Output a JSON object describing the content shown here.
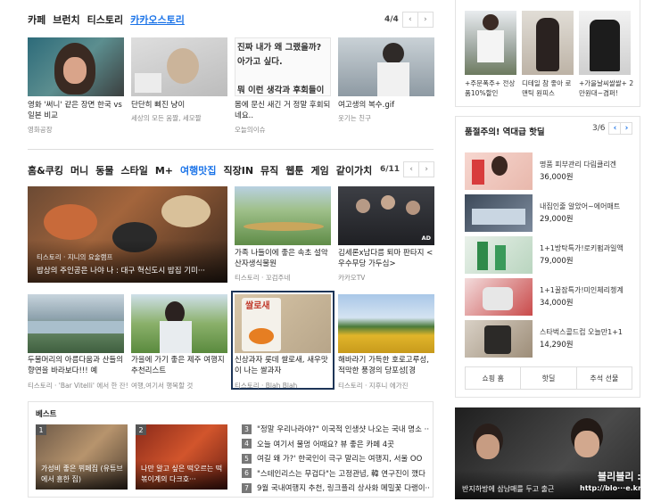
{
  "section1": {
    "tabs": [
      "카페",
      "브런치",
      "티스토리",
      "카카오스토리"
    ],
    "active_tab": 3,
    "page": "4/4",
    "cards": [
      {
        "title": "영화 '써니' 같은 장면 한국 vs 일본 비교",
        "source": "영화공장"
      },
      {
        "title": "단단히 삐진 냥이",
        "source": "세상의 모든 움짤, 세모짤"
      },
      {
        "title": "몸에 문신 새긴 거 정말 후회되네요..",
        "source": "오늘의이슈",
        "thumb_text": [
          "진짜 내가 왜 그랬을까?",
          "아가고 싶다.",
          "뭐 이런 생각과 후회들이"
        ]
      },
      {
        "title": "여고생의 복수.gif",
        "source": "웃기는 친구"
      }
    ]
  },
  "section2": {
    "tabs": [
      "홈&쿠킹",
      "머니",
      "동물",
      "스타일",
      "M+",
      "여행맛집",
      "직장IN",
      "뮤직",
      "웹툰",
      "게임",
      "같이가치"
    ],
    "active_tab": 5,
    "page": "6/11",
    "featured": {
      "source": "티스토리 · 지니의 요술램프",
      "title": "밥상의 주인공은 나야 나 : 대구 혁신도시 밥집 기미···"
    },
    "cards": [
      {
        "title": "가족 나들이에 좋은 속초 설악산자생식물원",
        "source": "티스토리 · 꼬검주네"
      },
      {
        "title": "김세론x남다름 퇴마 판타지 <우수무당 가두심>",
        "source": "카카오TV",
        "ad": "AD"
      },
      {
        "title": "두물머리의 아름다움과 산들의 향연을 바라보다!!! 예",
        "source": "티스토리 · 'Bar Vitelli' 에서 한 잔!"
      },
      {
        "title": "가을에 가기 좋은 제주 여행지 추천리스트",
        "source": "여행,여기서 행복할 것"
      },
      {
        "title": "신상과자 롯데 쌀로새, 새우맛이 나는 쌀과자",
        "source": "티스토리 · Blah Blah",
        "thumb_text": "쌀로새"
      },
      {
        "title": "해바라기 가득한 호로고루성, 적막한 풍경의 당포성[경",
        "source": "티스토리 · 지후니 에가진"
      }
    ]
  },
  "best": {
    "label": "베스트",
    "cards": [
      {
        "rank": "1",
        "title": "가성비 좋은 뷔페집 (유튜브에서 흥한 집)"
      },
      {
        "rank": "2",
        "title": "나만 알고 싶은 떡오르는 떡볶이계의 다크호···"
      }
    ],
    "list": [
      {
        "rank": "3",
        "title": "\"정말 우리나라야?\" 이국적 인생샷 나오는 국내 명소 ···"
      },
      {
        "rank": "4",
        "title": "오늘 여기서 물멍 어때요? 뷰 좋은 카페 4곳"
      },
      {
        "rank": "5",
        "title": "여길 왜 가?' 한국인이 극구 말리는 여행지, 서울 OO"
      },
      {
        "rank": "6",
        "title": "\"스테인리스는 무겁다\"는 고정관념, 韓 연구진이 깼다"
      },
      {
        "rank": "7",
        "title": "9월 국내여행지 추천, 링크플리 상사화 메밀꽃 다랭이···"
      }
    ]
  },
  "sidebar": {
    "top_items": [
      {
        "text": "+주문폭주+ 전상품10%할인"
      },
      {
        "text": "디테일 참 좋아 로맨틱 원피스"
      },
      {
        "text": "+가을날씨쌀쌀+ 2만원대~겸퍼!"
      }
    ],
    "hot": {
      "title": "품절주의! 역대급 핫딜",
      "page": "3/6",
      "items": [
        {
          "name": "명품 피부관리 다림클리겐",
          "price": "36,000원"
        },
        {
          "name": "내집인줄 알았어~에어매트",
          "price": "29,000원"
        },
        {
          "name": "1+1방탁특가!로키펌과일액",
          "price": "79,000원"
        },
        {
          "name": "1+1꿀잠특가!미인체리쳉계",
          "price": "34,000원"
        },
        {
          "name": "스타벅스콜드컵 오늘만1+1",
          "price": "14,290원"
        }
      ],
      "tabs": [
        "쇼핑 홈",
        "핫딜",
        "추석 선물"
      ]
    },
    "video": {
      "caption": "반지하방에 삼남매를 두고 출근",
      "watermark": "블리블리 :)",
      "url": "http://blo···e.kr"
    }
  },
  "colors": {
    "accent": "#1a73e8",
    "border": "#dddddd",
    "navy": "#1d3557"
  }
}
